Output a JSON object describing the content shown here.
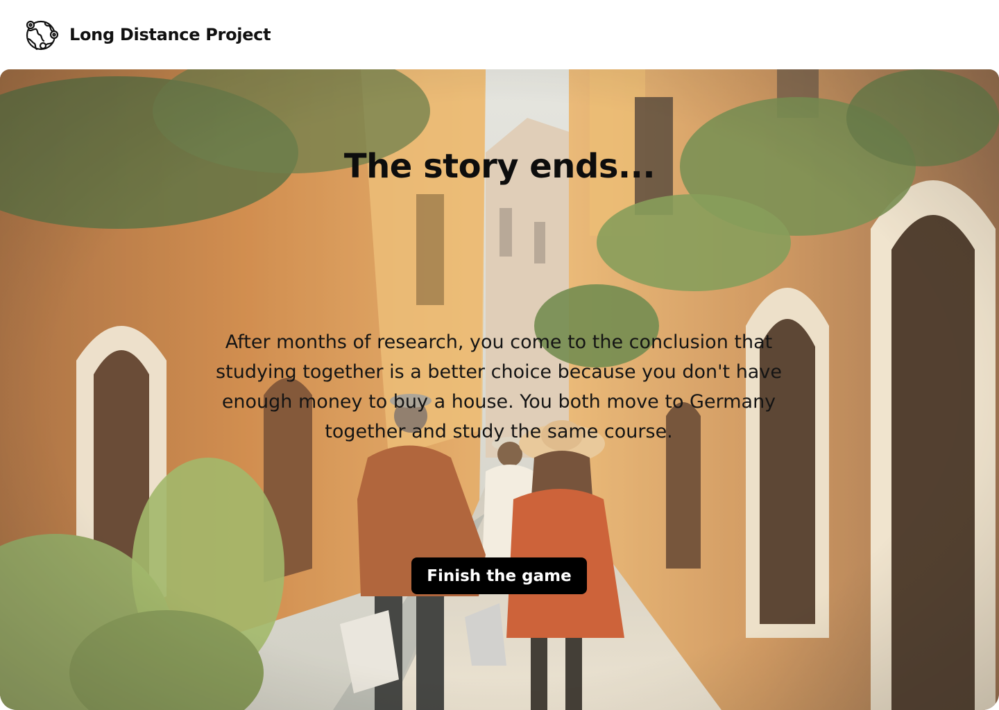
{
  "header": {
    "brand": "Long Distance Project",
    "logo_icon": "globe-with-map-pins-icon"
  },
  "main": {
    "title": "The story ends...",
    "story": "After months of research, you come to the conclusion that studying together is a better choice because you don't have enough money to buy a house. You both move to Germany together and study the same course.",
    "finish_label": "Finish the game",
    "background": "oil-painting-couple-walking-down-street"
  },
  "colors": {
    "button_bg": "#000000",
    "button_text": "#ffffff",
    "text": "#0d0d0d"
  }
}
